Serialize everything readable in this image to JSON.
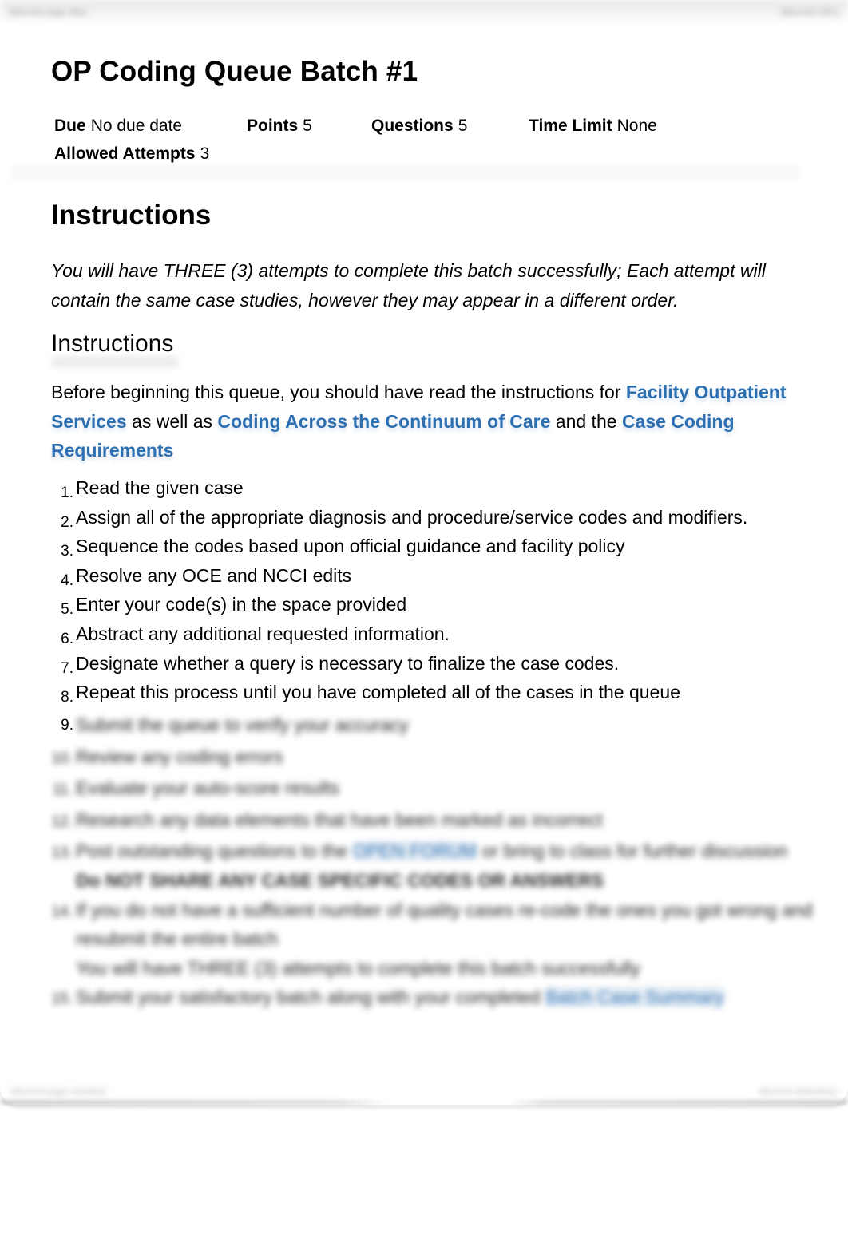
{
  "print_header": {
    "left": "[blurred page title]",
    "right": "[blurred URL]",
    "text_status": "illegible in source; placeholders only"
  },
  "title": "OP Coding Queue Batch #1",
  "meta": {
    "due": {
      "label": "Due",
      "value": "No due date"
    },
    "points": {
      "label": "Points",
      "value": "5"
    },
    "questions": {
      "label": "Questions",
      "value": "5"
    },
    "time_limit": {
      "label": "Time Limit",
      "value": "None"
    },
    "allowed_attempts": {
      "label": "Allowed Attempts",
      "value": "3"
    }
  },
  "instructions_heading": "Instructions",
  "intro_italic": "You will have THREE (3) attempts to complete this batch successfully; Each attempt will contain the same case studies, however they may appear in a different order.",
  "sub_heading": "Instructions",
  "paragraph": {
    "before": "Before beginning this queue, you should have read the instructions for ",
    "link1": "Facility Outpatient Services",
    "mid1": " as well as ",
    "link2": "Coding Across the Continuum of Care",
    "mid2": " and the ",
    "link3": "Case Coding Requirements"
  },
  "colors": {
    "link": "#2d6fb0",
    "text": "#000000"
  },
  "steps": [
    {
      "num": "1.",
      "text": "Read the given case"
    },
    {
      "num": "2.",
      "text": "Assign all of the appropriate diagnosis and procedure/service codes and modifiers."
    },
    {
      "num": "3.",
      "text": "Sequence the codes based upon official guidance and facility policy"
    },
    {
      "num": "4.",
      "text": "Resolve any OCE and NCCI edits"
    },
    {
      "num": "5.",
      "text": "Enter your code(s) in the space provided"
    },
    {
      "num": "6.",
      "text": "Abstract any additional requested information."
    },
    {
      "num": "7.",
      "text": "Designate whether a query is necessary to finalize the case codes."
    },
    {
      "num": "8.",
      "text": "Repeat this process until you have completed all of the cases in the queue"
    }
  ],
  "blurred_steps_note": "Items 9-15 are blurred in the source. Only the '9.' marker is legible; all text below is inferred from line shapes and context, not transcribed.",
  "blurred_steps": [
    {
      "num": "9.",
      "text": "Submit the queue to verify your accuracy",
      "legibility": "inferred"
    },
    {
      "num": "10.",
      "text": "Review any coding errors",
      "legibility": "inferred"
    },
    {
      "num": "11.",
      "text": "Evaluate your auto-score results",
      "legibility": "inferred"
    },
    {
      "num": "12.",
      "text": "Research any data elements that have been marked as incorrect",
      "legibility": "inferred"
    },
    {
      "num": "13.",
      "text_before": "Post outstanding questions to the ",
      "link": "OPEN FORUM",
      "text_after": " or bring to class for further discussion",
      "bold_line": "Do NOT SHARE ANY CASE SPECIFIC CODES OR ANSWERS",
      "legibility": "inferred"
    },
    {
      "num": "14.",
      "text": "If you do not have a sufficient number of quality cases re-code the ones you got wrong and resubmit the entire batch",
      "sub_line": "You will have THREE (3) attempts to complete this batch successfully",
      "legibility": "inferred"
    },
    {
      "num": "15.",
      "text_before": "Submit your satisfactory batch along with your completed ",
      "link": "Batch Case Summary",
      "legibility": "inferred"
    }
  ],
  "print_footer": {
    "left": "[blurred page number]",
    "right": "[blurred date/time]",
    "text_status": "illegible in source; placeholders only"
  }
}
